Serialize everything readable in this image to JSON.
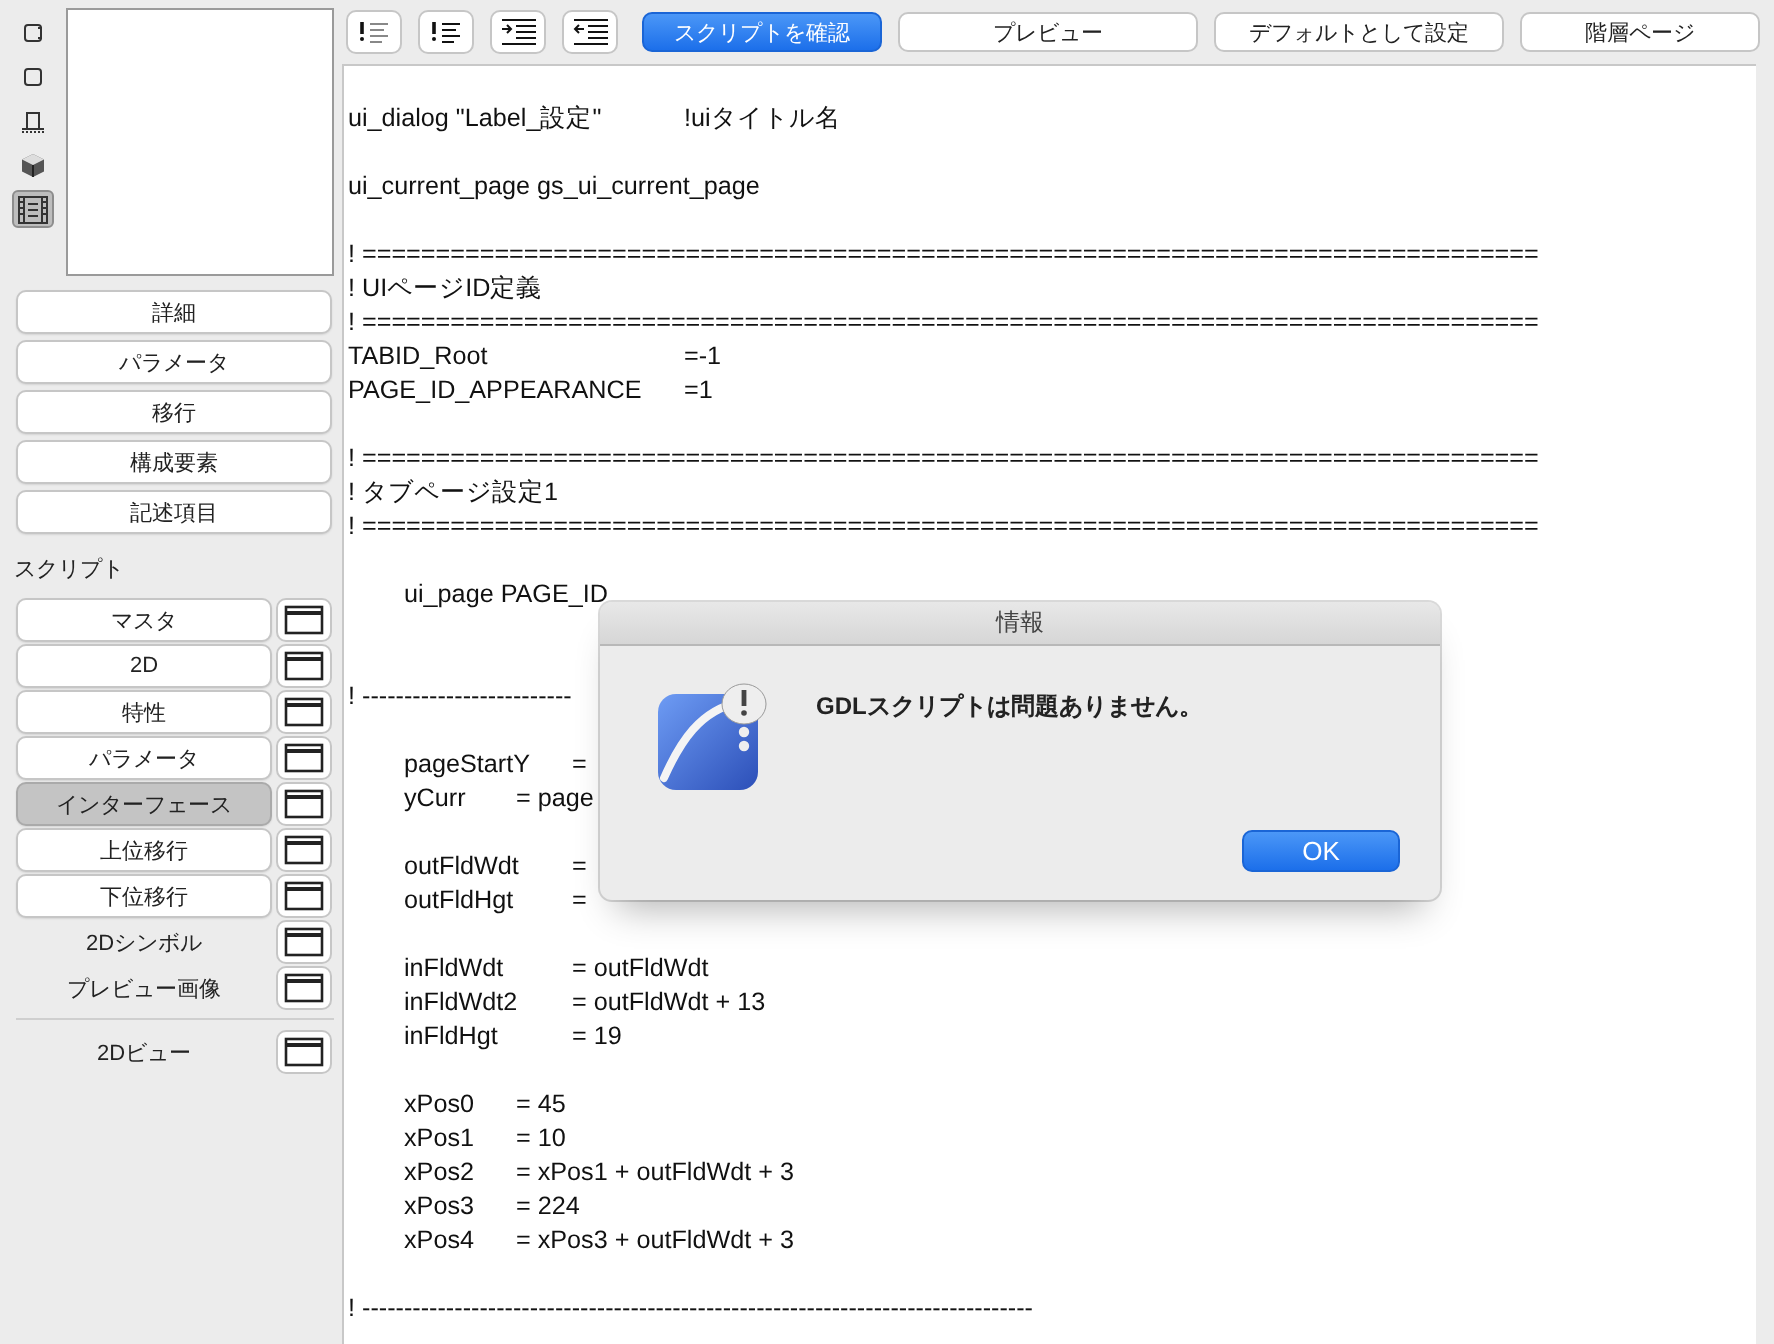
{
  "sidebar": {
    "view_icons": [
      {
        "kind": "frame",
        "selected": false
      },
      {
        "kind": "square",
        "selected": false
      },
      {
        "kind": "table",
        "selected": false
      },
      {
        "kind": "cube",
        "selected": false
      },
      {
        "kind": "film",
        "selected": true
      }
    ],
    "buttons": [
      "詳細",
      "パラメータ",
      "移行",
      "構成要素",
      "記述項目"
    ],
    "script_label": "スクリプト",
    "scripts": [
      {
        "label": "マスタ",
        "kind": "button",
        "selected": false
      },
      {
        "label": "2D",
        "kind": "button",
        "selected": false
      },
      {
        "label": "特性",
        "kind": "button",
        "selected": false
      },
      {
        "label": "パラメータ",
        "kind": "button",
        "selected": false
      },
      {
        "label": "インターフェース",
        "kind": "button",
        "selected": true
      },
      {
        "label": "上位移行",
        "kind": "button",
        "selected": false
      },
      {
        "label": "下位移行",
        "kind": "button",
        "selected": false
      },
      {
        "label": "2Dシンボル",
        "kind": "plain",
        "selected": false
      },
      {
        "label": "プレビュー画像",
        "kind": "plain",
        "selected": false
      }
    ],
    "views": [
      {
        "label": "2Dビュー",
        "kind": "plain",
        "selected": false
      }
    ]
  },
  "toolbar": {
    "format_buttons": [
      {
        "kind": "comment"
      },
      {
        "kind": "uncomment"
      },
      {
        "kind": "indent"
      },
      {
        "kind": "outdent"
      }
    ],
    "buttons": [
      {
        "label": "スクリプトを確認",
        "primary": true
      },
      {
        "label": "プレビュー",
        "primary": false
      },
      {
        "label": "デフォルトとして設定",
        "primary": false
      },
      {
        "label": "階層ページ",
        "primary": false
      }
    ]
  },
  "editor": {
    "lines": [
      {
        "kind": "code",
        "text": "ui_dialog \"Label_設定\"\t\t!uiタイトル名"
      },
      {
        "kind": "blank"
      },
      {
        "kind": "code",
        "text": "ui_current_page gs_ui_current_page"
      },
      {
        "kind": "blank"
      },
      {
        "kind": "code",
        "text": "! ================================================================================"
      },
      {
        "kind": "code",
        "text": "! UIページID定義"
      },
      {
        "kind": "code",
        "text": "! ================================================================================"
      },
      {
        "kind": "code",
        "text": "TABID_Root\t\t\t\t=-1"
      },
      {
        "kind": "code",
        "text": "PAGE_ID_APPEARANCE\t=1"
      },
      {
        "kind": "blank"
      },
      {
        "kind": "code",
        "text": "! ================================================================================"
      },
      {
        "kind": "code",
        "text": "! タブページ設定1"
      },
      {
        "kind": "code",
        "text": "! ================================================================================"
      },
      {
        "kind": "blank"
      },
      {
        "kind": "code",
        "text": "\tui_page PAGE_ID"
      },
      {
        "kind": "blank"
      },
      {
        "kind": "blank"
      },
      {
        "kind": "code",
        "text": "! -------------------------"
      },
      {
        "kind": "blank"
      },
      {
        "kind": "code",
        "text": "\tpageStartY\t="
      },
      {
        "kind": "code",
        "text": "\tyCurr\t= page"
      },
      {
        "kind": "blank"
      },
      {
        "kind": "code",
        "text": "\toutFldWdt\t="
      },
      {
        "kind": "code",
        "text": "\toutFldHgt\t="
      },
      {
        "kind": "blank"
      },
      {
        "kind": "code",
        "text": "\tinFldWdt\t\t= outFldWdt"
      },
      {
        "kind": "code",
        "text": "\tinFldWdt2\t= outFldWdt + 13"
      },
      {
        "kind": "code",
        "text": "\tinFldHgt\t\t= 19"
      },
      {
        "kind": "blank"
      },
      {
        "kind": "code",
        "text": "\txPos0\t= 45"
      },
      {
        "kind": "code",
        "text": "\txPos1\t= 10"
      },
      {
        "kind": "code",
        "text": "\txPos2\t= xPos1 + outFldWdt + 3"
      },
      {
        "kind": "code",
        "text": "\txPos3\t= 224"
      },
      {
        "kind": "code",
        "text": "\txPos4\t= xPos3 + outFldWdt + 3"
      },
      {
        "kind": "blank"
      },
      {
        "kind": "code",
        "text": "! --------------------------------------------------------------------------------"
      }
    ]
  },
  "dialog": {
    "title": "情報",
    "message": "GDLスクリプトは問題ありません。",
    "button": "OK"
  }
}
